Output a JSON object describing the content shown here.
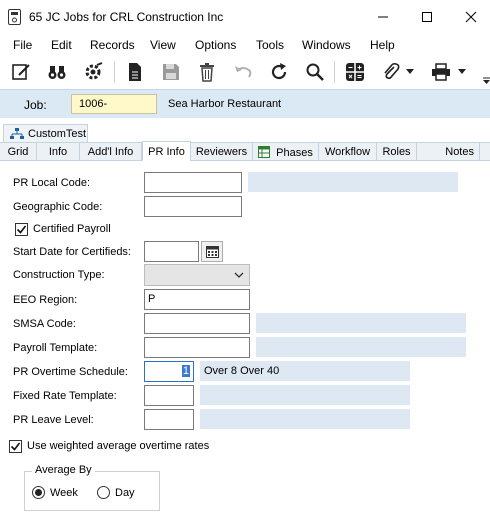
{
  "window": {
    "title": "65 JC Jobs for CRL Construction Inc",
    "minimize_icon": "minimize-icon",
    "maximize_icon": "maximize-icon",
    "close_icon": "close-icon"
  },
  "menu": [
    "File",
    "Edit",
    "Records",
    "View",
    "Options",
    "Tools",
    "Windows",
    "Help"
  ],
  "toolbar": [
    "edit-form-icon",
    "binoculars-icon",
    "settings-gear-icon",
    "document-icon",
    "save-icon",
    "delete-icon",
    "undo-icon",
    "refresh-icon",
    "search-icon",
    "calculator-icon",
    "attachment-icon",
    "printer-icon"
  ],
  "job": {
    "label": "Job:",
    "value": "1006-",
    "name": "Sea Harbor Restaurant"
  },
  "custom_tab": "CustomTest",
  "tabs": [
    "Grid",
    "Info",
    "Add'l Info",
    "PR Info",
    "Reviewers",
    "Phases",
    "Workflow",
    "Roles",
    "Notes"
  ],
  "active_tab": "PR Info",
  "form": {
    "pr_local_code": {
      "label": "PR Local Code:",
      "value": "",
      "description": ""
    },
    "geographic_code": {
      "label": "Geographic Code:",
      "value": ""
    },
    "certified_payroll": {
      "label": "Certified Payroll",
      "checked": true
    },
    "start_date": {
      "label": "Start Date for Certifieds:",
      "value": ""
    },
    "construction_type": {
      "label": "Construction Type:",
      "value": ""
    },
    "eeo_region": {
      "label": "EEO Region:",
      "value": "P"
    },
    "smsa_code": {
      "label": "SMSA Code:",
      "value": "",
      "description": ""
    },
    "payroll_template": {
      "label": "Payroll Template:",
      "value": "",
      "description": ""
    },
    "pr_overtime_schedule": {
      "label": "PR Overtime Schedule:",
      "value": "1",
      "description": "Over 8 Over 40"
    },
    "fixed_rate_template": {
      "label": "Fixed Rate Template:",
      "value": "",
      "description": ""
    },
    "pr_leave_level": {
      "label": "PR Leave Level:",
      "value": "",
      "description": ""
    },
    "weighted_avg": {
      "label": "Use weighted average overtime rates",
      "checked": true
    },
    "average_by": {
      "label": "Average By",
      "options": [
        "Week",
        "Day"
      ],
      "selected": "Week"
    }
  }
}
